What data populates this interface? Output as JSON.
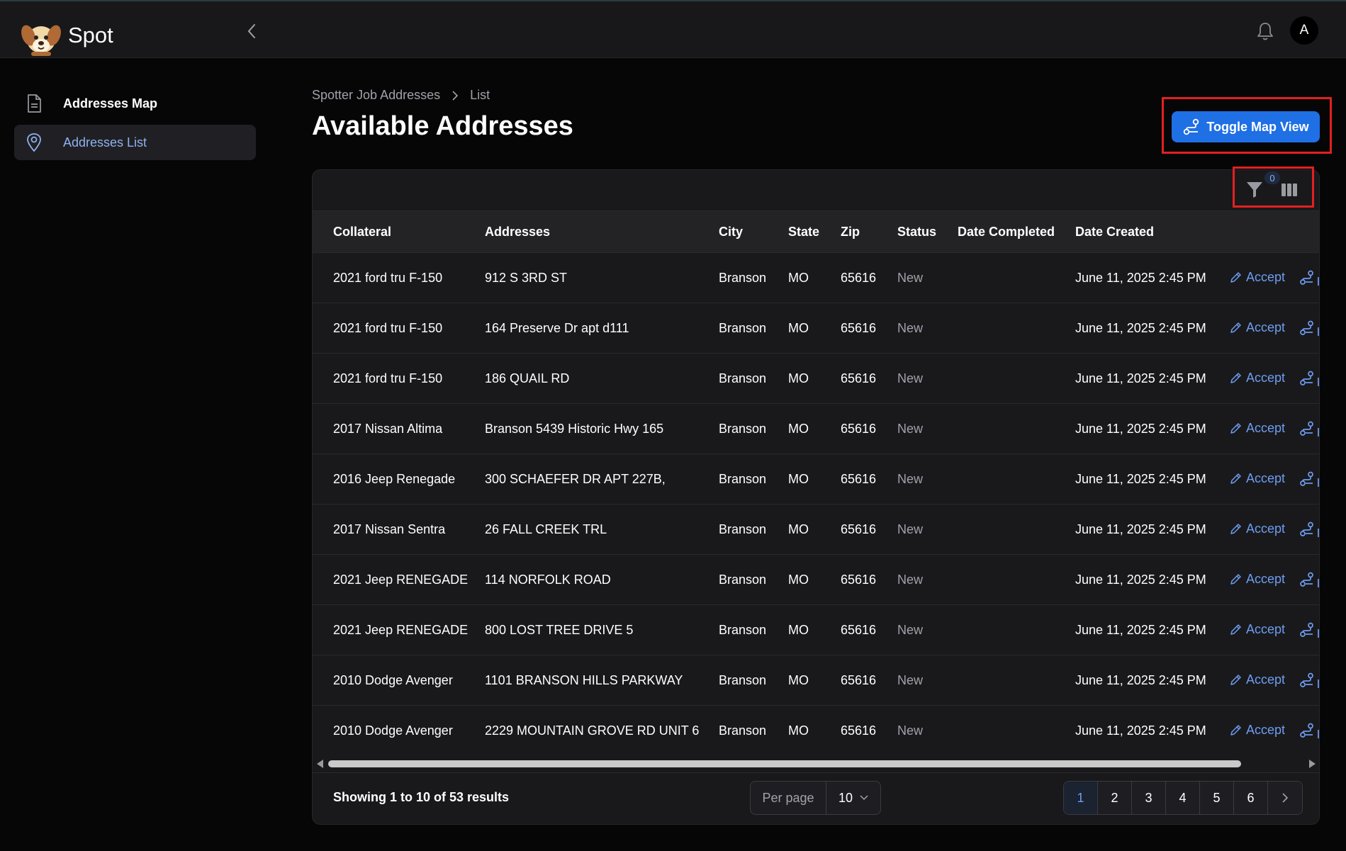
{
  "app": {
    "name": "Spot",
    "avatar_initial": "A"
  },
  "sidebar": {
    "items": [
      {
        "label": "Addresses Map",
        "icon": "document-icon",
        "active": false
      },
      {
        "label": "Addresses List",
        "icon": "map-pin-icon",
        "active": true
      }
    ]
  },
  "breadcrumb": {
    "parent": "Spotter Job Addresses",
    "current": "List"
  },
  "page": {
    "title": "Available Addresses",
    "toggle_label": "Toggle Map View"
  },
  "table": {
    "filter_count": "0",
    "columns": [
      "Collateral",
      "Addresses",
      "City",
      "State",
      "Zip",
      "Status",
      "Date Completed",
      "Date Created"
    ],
    "action_label": "Accept",
    "rows": [
      [
        "2021 ford tru F-150",
        "912 S 3RD ST",
        "Branson",
        "MO",
        "65616",
        "New",
        "",
        "June 11, 2025 2:45 PM"
      ],
      [
        "2021 ford tru F-150",
        "164 Preserve Dr apt d111",
        "Branson",
        "MO",
        "65616",
        "New",
        "",
        "June 11, 2025 2:45 PM"
      ],
      [
        "2021 ford tru F-150",
        "186 QUAIL RD",
        "Branson",
        "MO",
        "65616",
        "New",
        "",
        "June 11, 2025 2:45 PM"
      ],
      [
        "2017 Nissan Altima",
        "Branson 5439 Historic Hwy 165",
        "Branson",
        "MO",
        "65616",
        "New",
        "",
        "June 11, 2025 2:45 PM"
      ],
      [
        "2016 Jeep Renegade",
        "300 SCHAEFER DR APT 227B,",
        "Branson",
        "MO",
        "65616",
        "New",
        "",
        "June 11, 2025 2:45 PM"
      ],
      [
        "2017 Nissan Sentra",
        "26 FALL CREEK TRL",
        "Branson",
        "MO",
        "65616",
        "New",
        "",
        "June 11, 2025 2:45 PM"
      ],
      [
        "2021 Jeep RENEGADE",
        "114 NORFOLK ROAD",
        "Branson",
        "MO",
        "65616",
        "New",
        "",
        "June 11, 2025 2:45 PM"
      ],
      [
        "2021 Jeep RENEGADE",
        "800 LOST TREE DRIVE 5",
        "Branson",
        "MO",
        "65616",
        "New",
        "",
        "June 11, 2025 2:45 PM"
      ],
      [
        "2010 Dodge Avenger",
        "1101 BRANSON HILLS PARKWAY",
        "Branson",
        "MO",
        "65616",
        "New",
        "",
        "June 11, 2025 2:45 PM"
      ],
      [
        "2010 Dodge Avenger",
        "2229 MOUNTAIN GROVE RD UNIT 6",
        "Branson",
        "MO",
        "65616",
        "New",
        "",
        "June 11, 2025 2:45 PM"
      ]
    ]
  },
  "footer": {
    "results_text": "Showing 1 to 10 of 53 results",
    "per_page_label": "Per page",
    "per_page_value": "10",
    "pages": [
      "1",
      "2",
      "3",
      "4",
      "5",
      "6"
    ],
    "current_page": "1"
  },
  "colors": {
    "accent": "#1f6fe5",
    "link": "#6e9df0",
    "highlight": "#e32020",
    "background": "#060607"
  }
}
